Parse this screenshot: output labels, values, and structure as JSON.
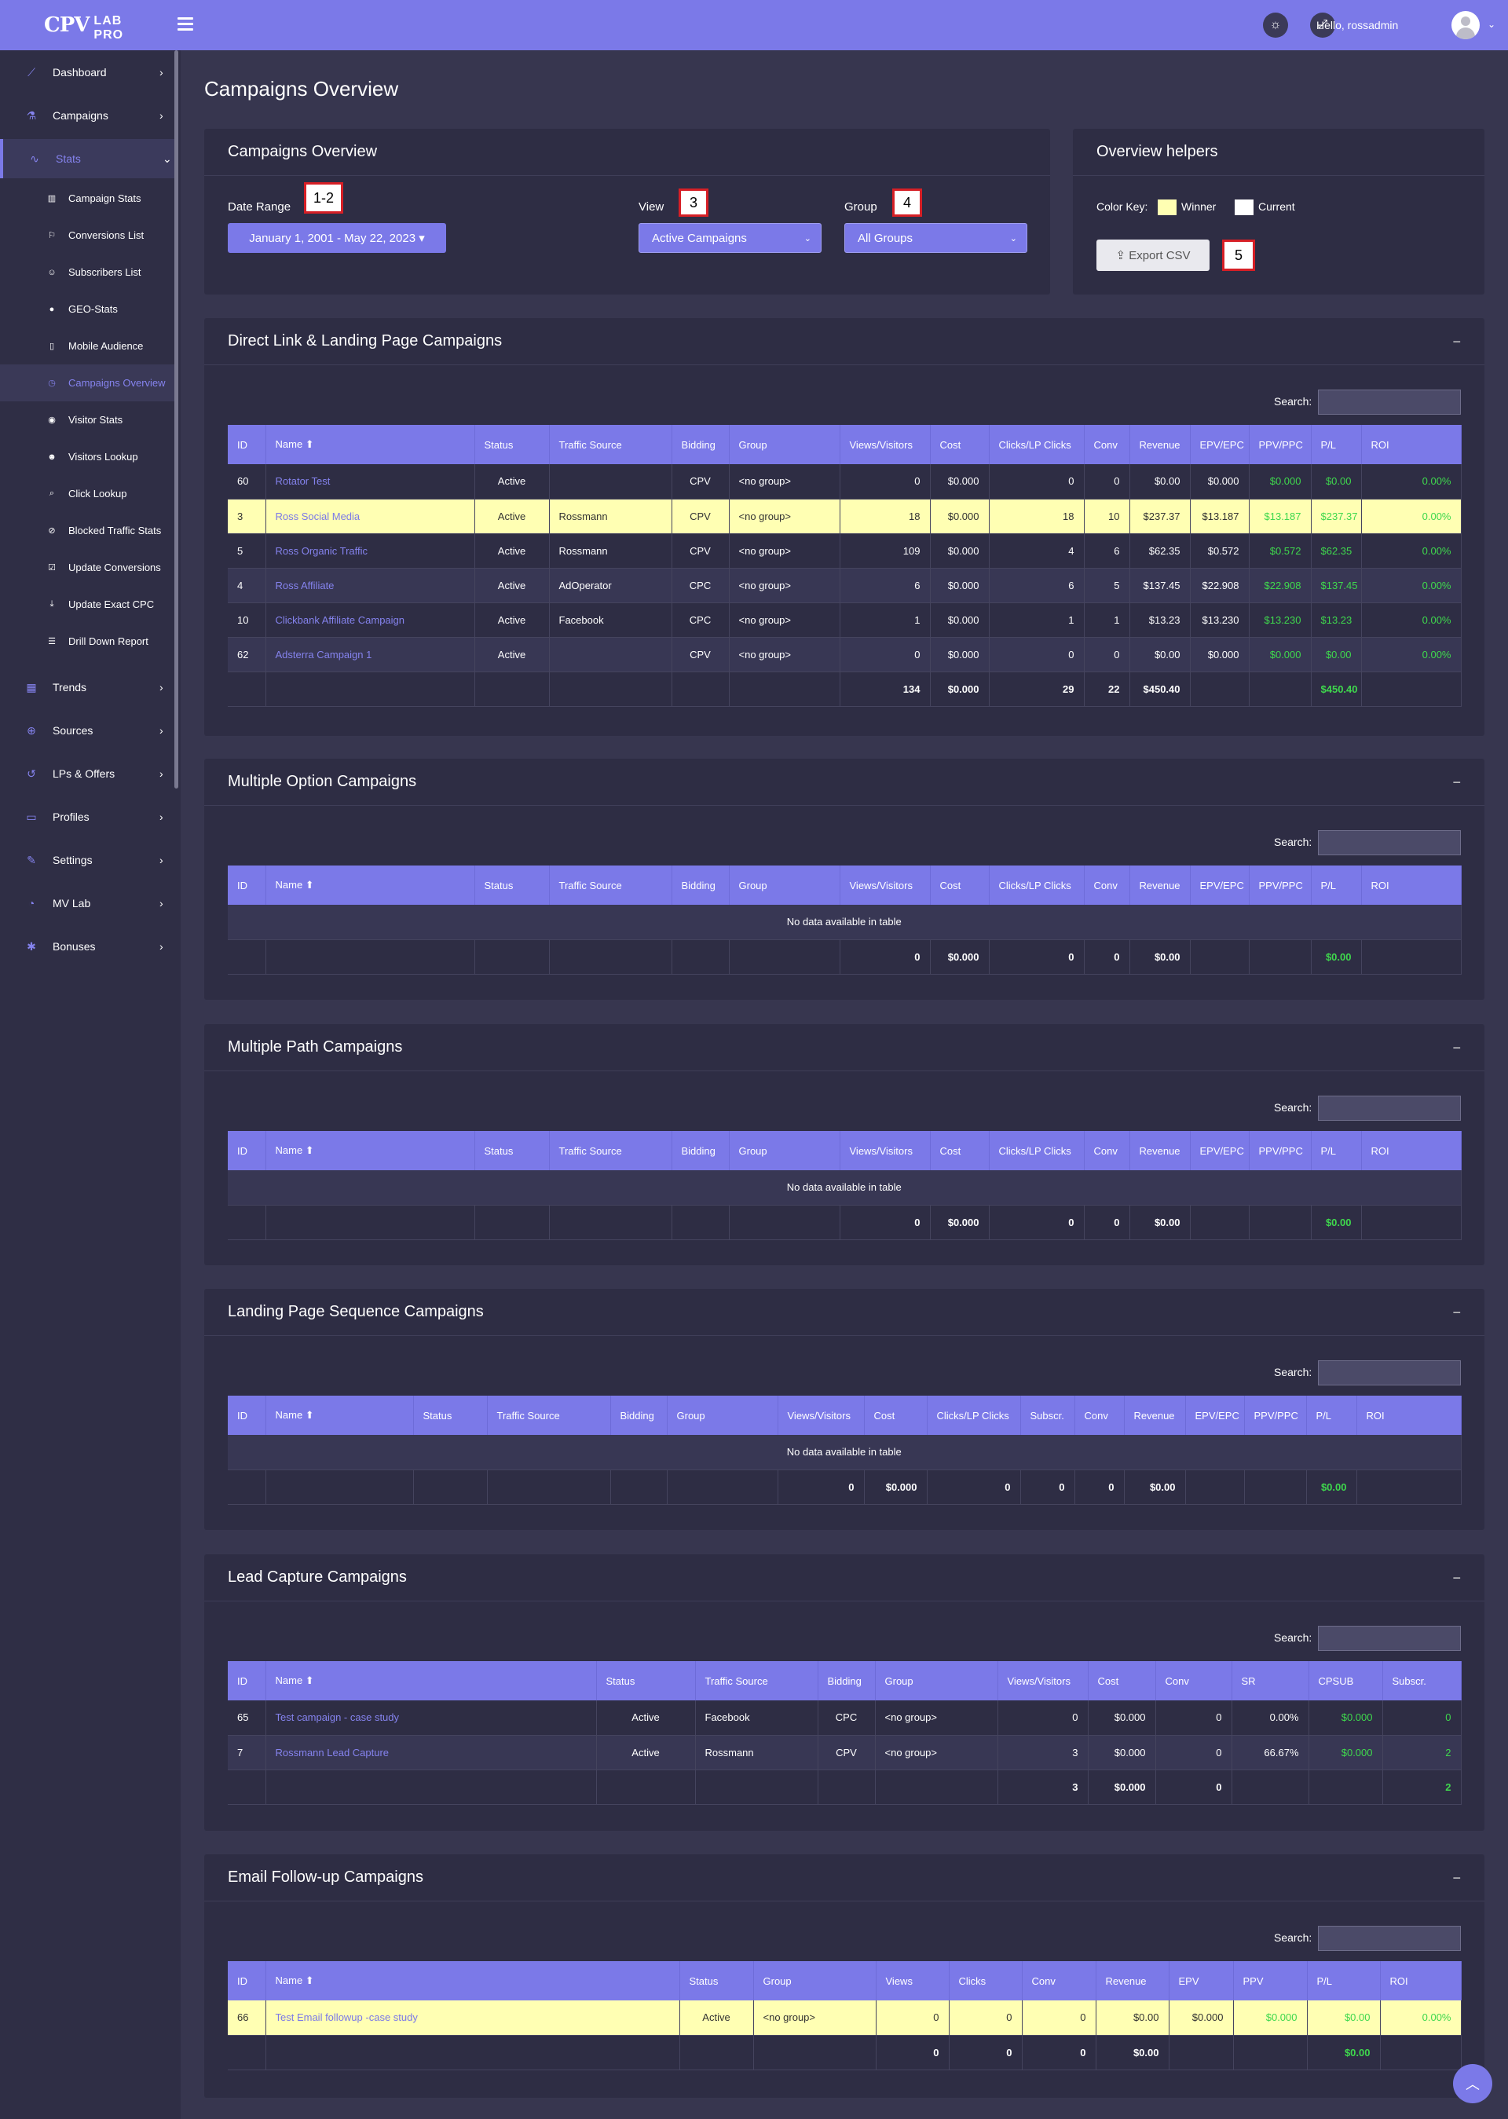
{
  "header": {
    "logo_cpv": "CPV",
    "logo_lab": "LAB PRO",
    "hello": "Hello, rossadmin"
  },
  "sidebar": {
    "items": [
      {
        "label": "Dashboard",
        "icon": "chart-line-icon"
      },
      {
        "label": "Campaigns",
        "icon": "flask-icon"
      },
      {
        "label": "Stats",
        "icon": "stats-icon"
      },
      {
        "label": "Trends",
        "icon": "trends-icon"
      },
      {
        "label": "Sources",
        "icon": "globe-icon"
      },
      {
        "label": "LPs & Offers",
        "icon": "history-icon"
      },
      {
        "label": "Profiles",
        "icon": "clipboard-icon"
      },
      {
        "label": "Settings",
        "icon": "wrench-icon"
      },
      {
        "label": "MV Lab",
        "icon": "mvlab-icon"
      },
      {
        "label": "Bonuses",
        "icon": "gift-icon"
      }
    ],
    "stats_sub": [
      "Campaign Stats",
      "Conversions List",
      "Subscribers List",
      "GEO-Stats",
      "Mobile Audience",
      "Campaigns Overview",
      "Visitor Stats",
      "Visitors Lookup",
      "Click Lookup",
      "Blocked Traffic Stats",
      "Update Conversions",
      "Update Exact CPC",
      "Drill Down Report"
    ]
  },
  "page_title": "Campaigns Overview",
  "filters": {
    "card_title": "Campaigns Overview",
    "date_label": "Date Range",
    "date_value": "January 1, 2001 - May 22, 2023",
    "view_label": "View",
    "view_value": "Active Campaigns",
    "group_label": "Group",
    "group_value": "All Groups",
    "badges": [
      "1-2",
      "3",
      "4",
      "5"
    ]
  },
  "helpers": {
    "title": "Overview helpers",
    "color_key": "Color Key:",
    "winner": "Winner",
    "current": "Current",
    "export": "Export CSV",
    "winner_color": "#ffffb3",
    "current_color": "#ffffff"
  },
  "search_label": "Search:",
  "no_data": "No data available in table",
  "cols_std": [
    "ID",
    "Name",
    "Status",
    "Traffic Source",
    "Bidding",
    "Group",
    "Views/Visitors",
    "Cost",
    "Clicks/LP Clicks",
    "Conv",
    "Revenue",
    "EPV/EPC",
    "PPV/PPC",
    "P/L",
    "ROI"
  ],
  "cols_lps": [
    "ID",
    "Name",
    "Status",
    "Traffic Source",
    "Bidding",
    "Group",
    "Views/Visitors",
    "Cost",
    "Clicks/LP Clicks",
    "Subscr.",
    "Conv",
    "Revenue",
    "EPV/EPC",
    "PPV/PPC",
    "P/L",
    "ROI"
  ],
  "cols_lead": [
    "ID",
    "Name",
    "Status",
    "Traffic Source",
    "Bidding",
    "Group",
    "Views/Visitors",
    "Cost",
    "Conv",
    "SR",
    "CPSUB",
    "Subscr."
  ],
  "cols_email": [
    "ID",
    "Name",
    "Status",
    "Group",
    "Views",
    "Clicks",
    "Conv",
    "Revenue",
    "EPV",
    "PPV",
    "P/L",
    "ROI"
  ],
  "direct": {
    "title": "Direct Link & Landing Page Campaigns",
    "rows": [
      [
        "60",
        "Rotator Test",
        "Active",
        "",
        "CPV",
        "<no group>",
        "0",
        "$0.000",
        "0",
        "0",
        "$0.00",
        "$0.000",
        "$0.000",
        "$0.00",
        "0.00%"
      ],
      [
        "3",
        "Ross Social Media",
        "Active",
        "Rossmann",
        "CPV",
        "<no group>",
        "18",
        "$0.000",
        "18",
        "10",
        "$237.37",
        "$13.187",
        "$13.187",
        "$237.37",
        "0.00%"
      ],
      [
        "5",
        "Ross Organic Traffic",
        "Active",
        "Rossmann",
        "CPV",
        "<no group>",
        "109",
        "$0.000",
        "4",
        "6",
        "$62.35",
        "$0.572",
        "$0.572",
        "$62.35",
        "0.00%"
      ],
      [
        "4",
        "Ross Affiliate",
        "Active",
        "AdOperator",
        "CPC",
        "<no group>",
        "6",
        "$0.000",
        "6",
        "5",
        "$137.45",
        "$22.908",
        "$22.908",
        "$137.45",
        "0.00%"
      ],
      [
        "10",
        "Clickbank Affiliate Campaign",
        "Active",
        "Facebook",
        "CPC",
        "<no group>",
        "1",
        "$0.000",
        "1",
        "1",
        "$13.23",
        "$13.230",
        "$13.230",
        "$13.23",
        "0.00%"
      ],
      [
        "62",
        "Adsterra Campaign 1",
        "Active",
        "",
        "CPV",
        "<no group>",
        "0",
        "$0.000",
        "0",
        "0",
        "$0.00",
        "$0.000",
        "$0.000",
        "$0.00",
        "0.00%"
      ]
    ],
    "foot": [
      "",
      "",
      "",
      "",
      "",
      "",
      "134",
      "$0.000",
      "29",
      "22",
      "$450.40",
      "",
      "",
      "$450.40",
      ""
    ]
  },
  "multi_option": {
    "title": "Multiple Option Campaigns",
    "foot": [
      "",
      "",
      "",
      "",
      "",
      "",
      "0",
      "$0.000",
      "0",
      "0",
      "$0.00",
      "",
      "",
      "$0.00",
      ""
    ]
  },
  "multi_path": {
    "title": "Multiple Path Campaigns",
    "foot": [
      "",
      "",
      "",
      "",
      "",
      "",
      "0",
      "$0.000",
      "0",
      "0",
      "$0.00",
      "",
      "",
      "$0.00",
      ""
    ]
  },
  "lps": {
    "title": "Landing Page Sequence Campaigns",
    "foot": [
      "",
      "",
      "",
      "",
      "",
      "",
      "0",
      "$0.000",
      "0",
      "0",
      "0",
      "$0.00",
      "",
      "",
      "$0.00",
      ""
    ]
  },
  "lead": {
    "title": "Lead Capture Campaigns",
    "rows": [
      [
        "65",
        "Test campaign - case study",
        "Active",
        "Facebook",
        "CPC",
        "<no group>",
        "0",
        "$0.000",
        "0",
        "0.00%",
        "$0.000",
        "0"
      ],
      [
        "7",
        "Rossmann Lead Capture",
        "Active",
        "Rossmann",
        "CPV",
        "<no group>",
        "3",
        "$0.000",
        "0",
        "66.67%",
        "$0.000",
        "2"
      ]
    ],
    "foot": [
      "",
      "",
      "",
      "",
      "",
      "",
      "3",
      "$0.000",
      "0",
      "",
      "",
      "2"
    ]
  },
  "email": {
    "title": "Email Follow-up Campaigns",
    "rows": [
      [
        "66",
        "Test Email followup -case study",
        "Active",
        "<no group>",
        "0",
        "0",
        "0",
        "$0.00",
        "$0.000",
        "$0.000",
        "$0.00",
        "0.00%"
      ]
    ],
    "foot": [
      "",
      "",
      "",
      "",
      "0",
      "0",
      "0",
      "$0.00",
      "",
      "",
      "$0.00",
      ""
    ]
  }
}
